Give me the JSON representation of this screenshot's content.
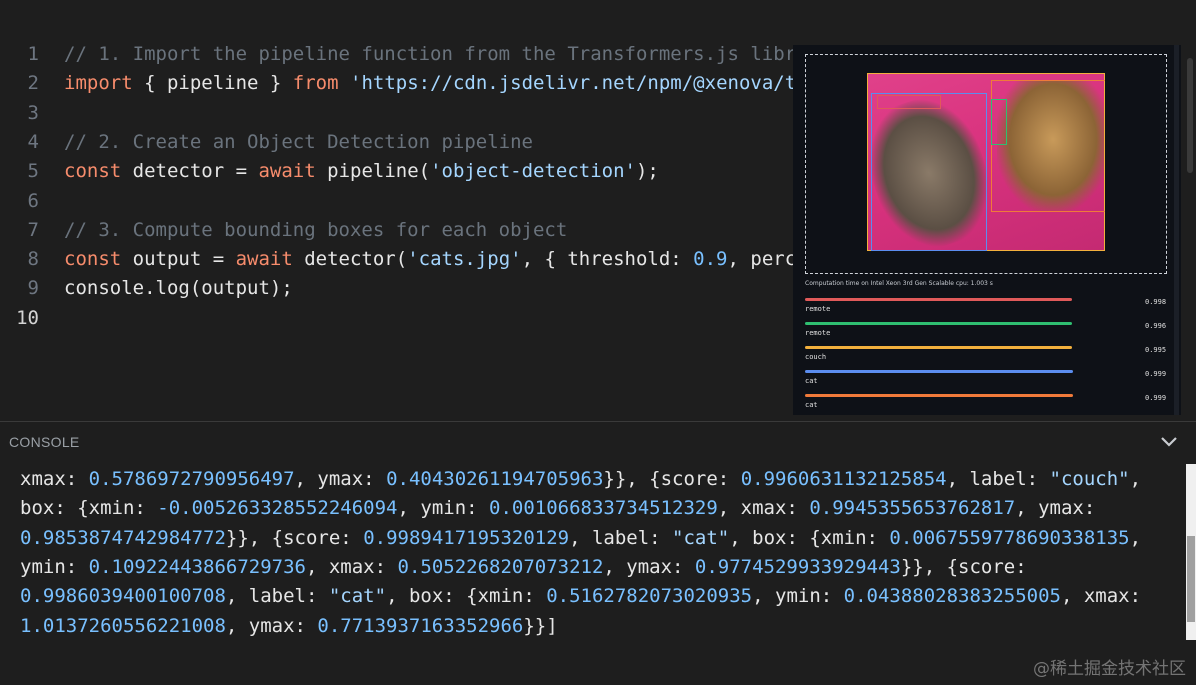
{
  "editor": {
    "lines": [
      {
        "n": "1",
        "parts": [
          {
            "t": "// 1. Import the pipeline function from the Transformers.js libr",
            "c": "cm"
          }
        ]
      },
      {
        "n": "2",
        "parts": [
          {
            "t": "import",
            "c": "kw"
          },
          {
            "t": " { pipeline } ",
            "c": "plain"
          },
          {
            "t": "from",
            "c": "kw"
          },
          {
            "t": " ",
            "c": "plain"
          },
          {
            "t": "'https://cdn.jsdelivr.net/npm/@xenova/t",
            "c": "str"
          }
        ]
      },
      {
        "n": "3",
        "parts": []
      },
      {
        "n": "4",
        "parts": [
          {
            "t": "// 2. Create an Object Detection pipeline",
            "c": "cm"
          }
        ]
      },
      {
        "n": "5",
        "parts": [
          {
            "t": "const",
            "c": "kw"
          },
          {
            "t": " detector = ",
            "c": "plain"
          },
          {
            "t": "await",
            "c": "kw"
          },
          {
            "t": " pipeline(",
            "c": "plain"
          },
          {
            "t": "'object-detection'",
            "c": "str"
          },
          {
            "t": ");",
            "c": "plain"
          }
        ]
      },
      {
        "n": "6",
        "parts": []
      },
      {
        "n": "7",
        "parts": [
          {
            "t": "// 3. Compute bounding boxes for each object",
            "c": "cm"
          }
        ]
      },
      {
        "n": "8",
        "parts": [
          {
            "t": "const",
            "c": "kw"
          },
          {
            "t": " output = ",
            "c": "plain"
          },
          {
            "t": "await",
            "c": "kw"
          },
          {
            "t": " detector(",
            "c": "plain"
          },
          {
            "t": "'cats.jpg'",
            "c": "str"
          },
          {
            "t": ", { threshold: ",
            "c": "plain"
          },
          {
            "t": "0.9",
            "c": "num"
          },
          {
            "t": ", perc",
            "c": "plain"
          }
        ]
      },
      {
        "n": "9",
        "parts": [
          {
            "t": "console.log(output);",
            "c": "plain"
          }
        ]
      },
      {
        "n": "10",
        "parts": []
      }
    ],
    "active_line": "10"
  },
  "preview": {
    "caption": "Computation time on Intel Xeon 3rd Gen Scalable cpu: 1.003 s",
    "detections": [
      {
        "label": "remote",
        "score": "0.998",
        "color": "#e05a5a"
      },
      {
        "label": "remote",
        "score": "0.996",
        "color": "#2fbf71"
      },
      {
        "label": "couch",
        "score": "0.995",
        "color": "#f2b03d"
      },
      {
        "label": "cat",
        "score": "0.999",
        "color": "#5b8def"
      },
      {
        "label": "cat",
        "score": "0.999",
        "color": "#f07a3a"
      }
    ]
  },
  "console": {
    "title": "CONSOLE",
    "lines": [
      [
        {
          "t": "xmax: ",
          "c": "plain"
        },
        {
          "t": "0.5786972790956497",
          "c": "num"
        },
        {
          "t": ", ymax: ",
          "c": "plain"
        },
        {
          "t": "0.40430261194705963",
          "c": "num"
        },
        {
          "t": "}}, {score: ",
          "c": "plain"
        },
        {
          "t": "0.9960631132125854",
          "c": "num"
        },
        {
          "t": ", label: ",
          "c": "plain"
        },
        {
          "t": "\"couch\"",
          "c": "str"
        },
        {
          "t": ",",
          "c": "plain"
        }
      ],
      [
        {
          "t": "box: {xmin: ",
          "c": "plain"
        },
        {
          "t": "-0.005263328552246094",
          "c": "num"
        },
        {
          "t": ", ymin: ",
          "c": "plain"
        },
        {
          "t": "0.001066833734512329",
          "c": "num"
        },
        {
          "t": ", xmax: ",
          "c": "plain"
        },
        {
          "t": "0.9945355653762817",
          "c": "num"
        },
        {
          "t": ", ymax:",
          "c": "plain"
        }
      ],
      [
        {
          "t": "0.9853874742984772",
          "c": "num"
        },
        {
          "t": "}}, {score: ",
          "c": "plain"
        },
        {
          "t": "0.9989417195320129",
          "c": "num"
        },
        {
          "t": ", label: ",
          "c": "plain"
        },
        {
          "t": "\"cat\"",
          "c": "str"
        },
        {
          "t": ", box: {xmin: ",
          "c": "plain"
        },
        {
          "t": "0.0067559778690338135",
          "c": "num"
        },
        {
          "t": ",",
          "c": "plain"
        }
      ],
      [
        {
          "t": "ymin: ",
          "c": "plain"
        },
        {
          "t": "0.10922443866729736",
          "c": "num"
        },
        {
          "t": ", xmax: ",
          "c": "plain"
        },
        {
          "t": "0.5052268207073212",
          "c": "num"
        },
        {
          "t": ", ymax: ",
          "c": "plain"
        },
        {
          "t": "0.9774529933929443",
          "c": "num"
        },
        {
          "t": "}}, {score:",
          "c": "plain"
        }
      ],
      [
        {
          "t": "0.9986039400100708",
          "c": "num"
        },
        {
          "t": ", label: ",
          "c": "plain"
        },
        {
          "t": "\"cat\"",
          "c": "str"
        },
        {
          "t": ", box: {xmin: ",
          "c": "plain"
        },
        {
          "t": "0.5162782073020935",
          "c": "num"
        },
        {
          "t": ", ymin: ",
          "c": "plain"
        },
        {
          "t": "0.04388028383255005",
          "c": "num"
        },
        {
          "t": ", xmax:",
          "c": "plain"
        }
      ],
      [
        {
          "t": "1.0137260556221008",
          "c": "num"
        },
        {
          "t": ", ymax: ",
          "c": "plain"
        },
        {
          "t": "0.7713937163352966",
          "c": "num"
        },
        {
          "t": "}}]",
          "c": "plain"
        }
      ]
    ]
  },
  "watermark": "@稀土掘金技术社区"
}
